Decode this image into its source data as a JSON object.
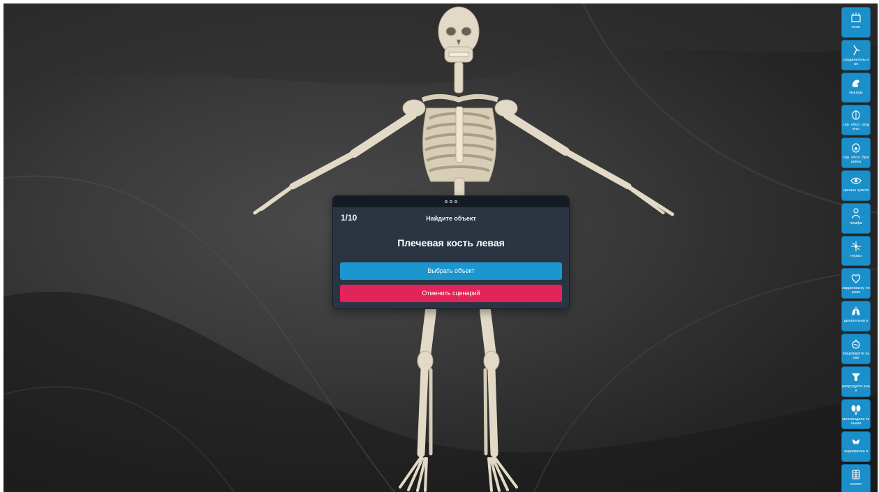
{
  "quiz": {
    "counter": "1/10",
    "instruction": "Найдите объект",
    "target": "Плечевая кость левая",
    "select_label": "Выбрать объект",
    "cancel_label": "Отменить сценарий"
  },
  "toolbar": {
    "items": [
      {
        "label": "кожа",
        "icon": "skin-icon"
      },
      {
        "label": "соединитель ная",
        "icon": "connective-tissue-icon"
      },
      {
        "label": "мышцы",
        "icon": "muscle-icon"
      },
      {
        "label": "сер. обол. грудины",
        "icon": "thoracic-serous-membrane-icon"
      },
      {
        "label": "сер. обол. брюшины",
        "icon": "peritoneum-icon"
      },
      {
        "label": "органы чувств",
        "icon": "eye-icon"
      },
      {
        "label": "лимфа",
        "icon": "lymph-icon"
      },
      {
        "label": "нервы",
        "icon": "nerves-icon"
      },
      {
        "label": "кардиоваску лярная",
        "icon": "heart-icon"
      },
      {
        "label": "дыхательна я",
        "icon": "lungs-icon"
      },
      {
        "label": "пищеварите льная",
        "icon": "stomach-icon"
      },
      {
        "label": "репродукти вная",
        "icon": "reproductive-icon"
      },
      {
        "label": "мочевыдели тельная",
        "icon": "kidneys-icon"
      },
      {
        "label": "эндокринна я",
        "icon": "thyroid-icon"
      },
      {
        "label": "скелет",
        "icon": "skeleton-icon"
      }
    ]
  },
  "colors": {
    "select_button": "#1b96cf",
    "cancel_button": "#e2245b",
    "toolbar_button": "#1b8fc9",
    "panel_background": "#2b3542",
    "bone": "#e2d9c6"
  }
}
